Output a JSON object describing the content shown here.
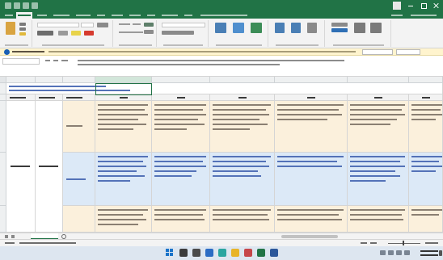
{
  "window": {
    "title": "",
    "user_name": ""
  },
  "ribbon": {
    "tabs": [
      {
        "label": ""
      },
      {
        "label": "",
        "active": true
      },
      {
        "label": ""
      },
      {
        "label": ""
      },
      {
        "label": ""
      },
      {
        "label": ""
      },
      {
        "label": ""
      },
      {
        "label": ""
      },
      {
        "label": ""
      },
      {
        "label": ""
      },
      {
        "label": ""
      },
      {
        "label": ""
      }
    ],
    "groups": [
      {
        "name": "clipboard"
      },
      {
        "name": "font"
      },
      {
        "name": "alignment"
      },
      {
        "name": "number"
      },
      {
        "name": "styles"
      },
      {
        "name": "cells"
      },
      {
        "name": "editing"
      }
    ],
    "font_name": "",
    "font_size": "",
    "number_format": ""
  },
  "message_bar": {
    "label": "",
    "text": "",
    "buttons": [
      {
        "label": ""
      },
      {
        "label": ""
      }
    ]
  },
  "formula_bar": {
    "name_box": "",
    "content": ""
  },
  "sheet": {
    "columns": [
      "",
      "",
      "",
      "",
      "",
      "",
      "",
      "",
      "",
      "",
      ""
    ],
    "rows": [
      "",
      "",
      "",
      "",
      "",
      "",
      "",
      ""
    ],
    "cells": []
  },
  "sheet_tabs": [
    {
      "label": "",
      "active": true
    }
  ],
  "status": {
    "text": "",
    "zoom": ""
  },
  "taskbar": {
    "time": "",
    "date": ""
  },
  "colors": {
    "accent": "#217346",
    "ribbon_background": "#f3f3f3",
    "message_bar": "#fff4ce",
    "row_band_tan": "#fbf0dc",
    "row_band_blue": "#dce9f7",
    "selection": "#217346"
  }
}
